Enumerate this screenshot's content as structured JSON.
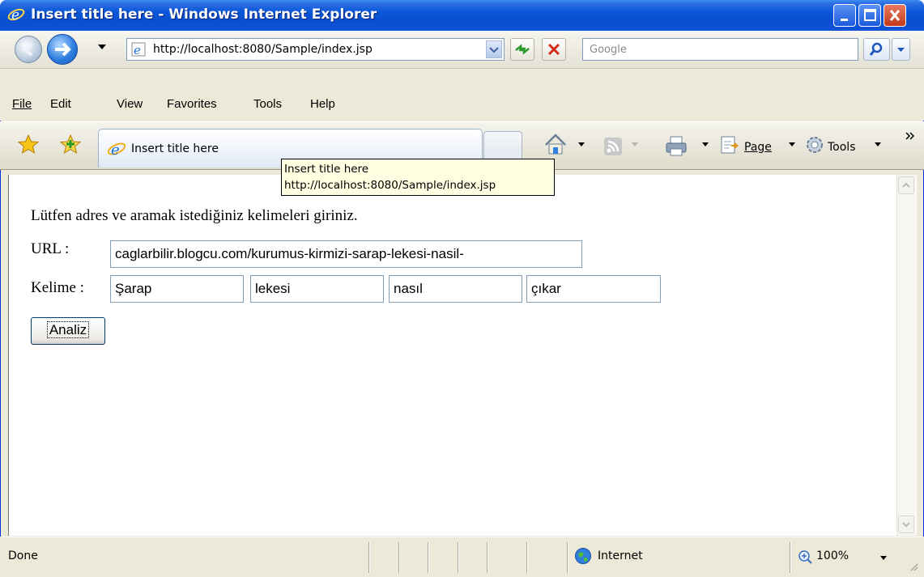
{
  "window": {
    "title": "Insert title here - Windows Internet Explorer"
  },
  "address": {
    "url": "http://localhost:8080/Sample/index.jsp",
    "search_placeholder": "Google"
  },
  "menu": {
    "items": [
      "File",
      "Edit",
      "View",
      "Favorites",
      "Tools",
      "Help"
    ]
  },
  "tab": {
    "label": "Insert title here"
  },
  "commands": {
    "page_label": "Page",
    "tools_label": "Tools"
  },
  "tooltip": {
    "line1": "Insert title here",
    "line2": "http://localhost:8080/Sample/index.jsp"
  },
  "form": {
    "prompt": "Lütfen adres ve aramak istediğiniz kelimeleri giriniz.",
    "url_label": "URL :",
    "url_value": "caglarbilir.blogcu.com/kurumus-kirmizi-sarap-lekesi-nasil-",
    "kelime_label": "Kelime :",
    "kelime_values": [
      "Şarap",
      "lekesi",
      "nasıl",
      "çıkar"
    ],
    "submit_label": "Analiz"
  },
  "status": {
    "text": "Done",
    "zone": "Internet",
    "zoom": "100%"
  },
  "colors": {
    "titlebar": "#0a56d8",
    "tooltip_bg": "#ffffe1",
    "input_border": "#7f9db9"
  },
  "icons": [
    "ie-icon",
    "back-icon",
    "forward-icon",
    "refresh-icon",
    "stop-icon",
    "search-icon",
    "favorites-star-icon",
    "add-favorites-icon",
    "home-icon",
    "feeds-icon",
    "print-icon",
    "page-icon",
    "tools-gear-icon",
    "globe-icon",
    "zoom-icon"
  ]
}
